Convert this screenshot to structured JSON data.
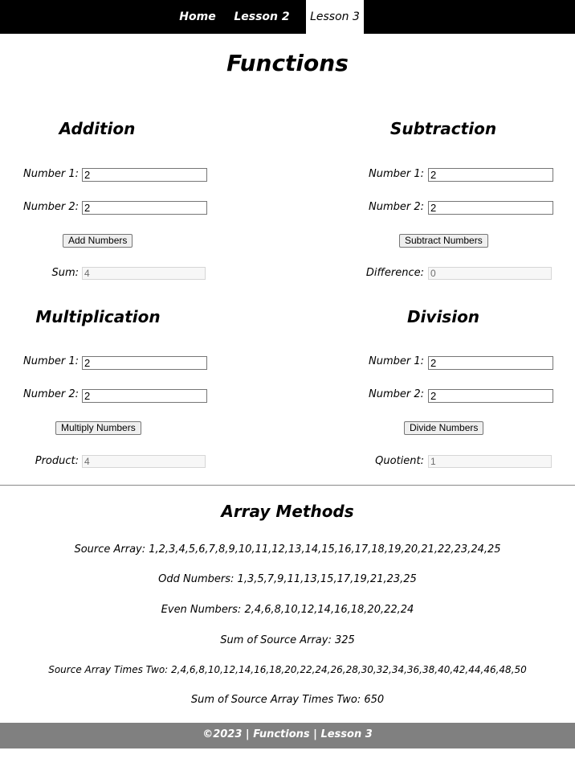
{
  "nav": {
    "home": "Home",
    "lesson2": "Lesson 2",
    "lesson3": "Lesson 3"
  },
  "page_title": "Functions",
  "addition": {
    "title": "Addition",
    "n1_label": "Number 1:",
    "n1_value": "2",
    "n2_label": "Number 2:",
    "n2_value": "2",
    "button": "Add Numbers",
    "result_label": "Sum:",
    "result_value": "4"
  },
  "subtraction": {
    "title": "Subtraction",
    "n1_label": "Number 1:",
    "n1_value": "2",
    "n2_label": "Number 2:",
    "n2_value": "2",
    "button": "Subtract Numbers",
    "result_label": "Difference:",
    "result_value": "0"
  },
  "multiplication": {
    "title": "Multiplication",
    "n1_label": "Number 1:",
    "n1_value": "2",
    "n2_label": "Number 2:",
    "n2_value": "2",
    "button": "Multiply Numbers",
    "result_label": "Product:",
    "result_value": "4"
  },
  "division": {
    "title": "Division",
    "n1_label": "Number 1:",
    "n1_value": "2",
    "n2_label": "Number 2:",
    "n2_value": "2",
    "button": "Divide Numbers",
    "result_label": "Quotient:",
    "result_value": "1"
  },
  "array_methods": {
    "title": "Array Methods",
    "lines": [
      "Source Array: 1,2,3,4,5,6,7,8,9,10,11,12,13,14,15,16,17,18,19,20,21,22,23,24,25",
      "Odd Numbers: 1,3,5,7,9,11,13,15,17,19,21,23,25",
      "Even Numbers: 2,4,6,8,10,12,14,16,18,20,22,24",
      "Sum of Source Array: 325",
      "Source Array Times Two: 2,4,6,8,10,12,14,16,18,20,22,24,26,28,30,32,34,36,38,40,42,44,46,48,50",
      "Sum of Source Array Times Two: 650"
    ]
  },
  "footer": "©2023 | Functions | Lesson 3"
}
